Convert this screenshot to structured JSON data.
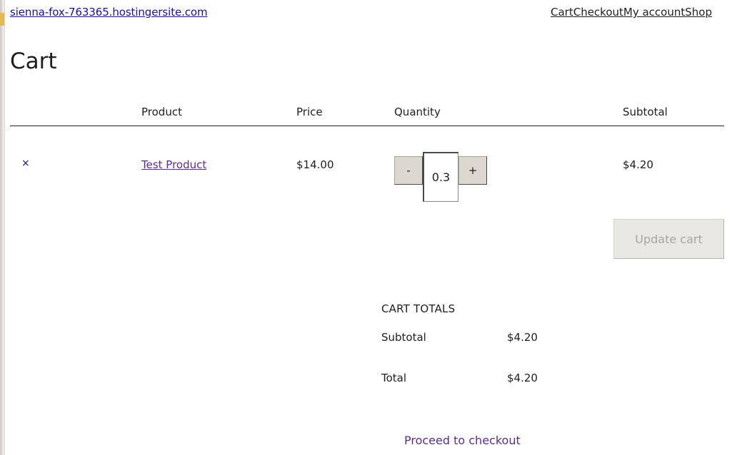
{
  "header": {
    "site_title": "sienna-fox-763365.hostingersite.com",
    "nav": [
      "Cart",
      "Checkout",
      "My account",
      "Shop"
    ]
  },
  "page": {
    "title": "Cart"
  },
  "cart": {
    "columns": {
      "product": "Product",
      "price": "Price",
      "quantity": "Quantity",
      "subtotal": "Subtotal"
    },
    "items": [
      {
        "remove_label": "×",
        "product": "Test Product",
        "price": "$14.00",
        "quantity": "0.3",
        "decrement_label": "-",
        "increment_label": "+",
        "subtotal": "$4.20"
      }
    ],
    "update_label": "Update cart"
  },
  "totals": {
    "heading": "CART TOTALS",
    "subtotal_label": "Subtotal",
    "subtotal_value": "$4.20",
    "total_label": "Total",
    "total_value": "$4.20",
    "checkout_label": "Proceed to checkout"
  },
  "colors": {
    "link_blue": "#1a0dab",
    "visited_purple": "#5b2d8e",
    "button_gray": "#dcd7cf"
  }
}
